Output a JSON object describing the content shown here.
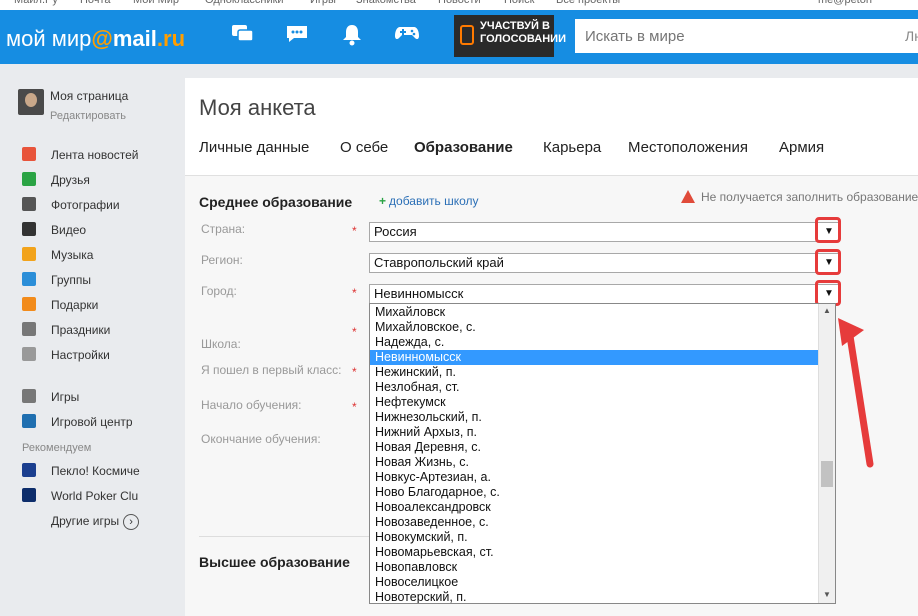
{
  "top_links": [
    "Майл.Ру",
    "Почта",
    "Мой Мир",
    "Одноклассники",
    "Игры",
    "Знакомства",
    "Новости",
    "Поиск",
    "Все проекты"
  ],
  "top_user": "me@peton",
  "header": {
    "logo_part1": "мой мир",
    "logo_at": "@",
    "logo_mail": "mail",
    "logo_ru": ".ru",
    "banner_text": "УЧАСТВУЙ В ГОЛОСОВАНИИ",
    "search_placeholder": "Искать в мире",
    "search_extra": "Лю",
    "icons": [
      "chat-icon",
      "messages-icon",
      "bell-icon",
      "gamepad-icon"
    ]
  },
  "sidebar": {
    "user_name": "Моя страница",
    "edit_label": "Редактировать",
    "items": [
      {
        "label": "Лента новостей",
        "icon": "house-icon",
        "color": "#e8543b"
      },
      {
        "label": "Друзья",
        "icon": "friends-icon",
        "color": "#2aa344"
      },
      {
        "label": "Фотографии",
        "icon": "camera-icon",
        "color": "#555555"
      },
      {
        "label": "Видео",
        "icon": "clapper-icon",
        "color": "#333333"
      },
      {
        "label": "Музыка",
        "icon": "music-icon",
        "color": "#f2a31b"
      },
      {
        "label": "Группы",
        "icon": "groups-icon",
        "color": "#2b8ed8"
      },
      {
        "label": "Подарки",
        "icon": "gift-icon",
        "color": "#f28b1b"
      },
      {
        "label": "Праздники",
        "icon": "calendar-icon",
        "color": "#777777"
      },
      {
        "label": "Настройки",
        "icon": "gear-icon",
        "color": "#999999"
      }
    ],
    "games": [
      {
        "label": "Игры",
        "icon": "gamepad-icon",
        "color": "#777777"
      },
      {
        "label": "Игровой центр",
        "icon": "game-center-icon",
        "color": "#1f6fb0"
      }
    ],
    "recommend_label": "Рекомендуем",
    "recommended": [
      {
        "label": "Пекло! Космиче",
        "icon": "space-game-icon",
        "color": "#1b3f8f"
      },
      {
        "label": "World Poker Clu",
        "icon": "poker-icon",
        "color": "#0d2d6b"
      }
    ],
    "more_games": "Другие игры",
    "more_icon": "›"
  },
  "main": {
    "title": "Моя анкета",
    "tabs": [
      "Личные данные",
      "О себе",
      "Образование",
      "Карьера",
      "Местоположения",
      "Армия"
    ],
    "active_tab": "Образование",
    "section_title": "Среднее образование",
    "add_school": "добавить школу",
    "warning": "Не получается заполнить образование",
    "fields": {
      "country_label": "Страна:",
      "country_value": "Россия",
      "region_label": "Регион:",
      "region_value": "Ставропольский край",
      "city_label": "Город:",
      "city_value": "Невинномысск",
      "school_label": "Школа:",
      "first_class_label": "Я пошел в первый класс:",
      "start_label": "Начало обучения:",
      "end_label": "Окончание обучения:"
    },
    "required_mark": "*",
    "higher_edu": "Высшее образование"
  },
  "dropdown": {
    "selected": "Невинномысск",
    "options": [
      "Михайловск",
      "Михайловское, с.",
      "Надежда, с.",
      "Невинномысск",
      "Нежинский, п.",
      "Незлобная, ст.",
      "Нефтекумск",
      "Нижнезольский, п.",
      "Нижний Архыз, п.",
      "Новая Деревня, с.",
      "Новая Жизнь, с.",
      "Новкус-Артезиан, а.",
      "Ново Благодарное, с.",
      "Новоалександровск",
      "Новозаведенное, с.",
      "Новокумский, п.",
      "Новомарьевская, ст.",
      "Новопавловск",
      "Новоселицкое",
      "Новотерский, п."
    ]
  },
  "colors": {
    "header": "#168de2",
    "accent_orange": "#ff9e00",
    "highlight_red": "#e63b3b",
    "selection": "#3399ff"
  }
}
